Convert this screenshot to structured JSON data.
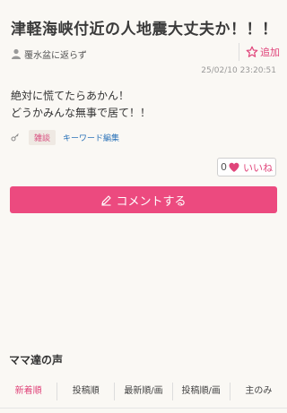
{
  "post": {
    "title": "津軽海峡付近の人地震大丈夫か！！！",
    "author": "覆水盆に返らず",
    "add_label": "追加",
    "timestamp": "25/02/10 23:20:51",
    "body_line1": "絶対に慌てたらあかん！",
    "body_line2": "どうかみんな無事で居て！！",
    "tag": "雑談",
    "keyword_edit": "キーワード編集",
    "like_count": "0",
    "like_label": "いいね"
  },
  "comment_button": "コメントする",
  "section_title": "ママ達の声",
  "tabs": [
    {
      "label": "新着順"
    },
    {
      "label": "投稿順"
    },
    {
      "label": "最新順/画"
    },
    {
      "label": "投稿順/画"
    },
    {
      "label": "主のみ"
    }
  ],
  "colors": {
    "accent": "#e0447a",
    "button": "#ec4a7f",
    "link": "#2a72b8",
    "background": "#faf8f4"
  },
  "icons": {
    "author": "person-icon",
    "favorite": "star-icon",
    "tag": "key-icon",
    "like": "heart-icon",
    "comment": "pen-icon"
  }
}
